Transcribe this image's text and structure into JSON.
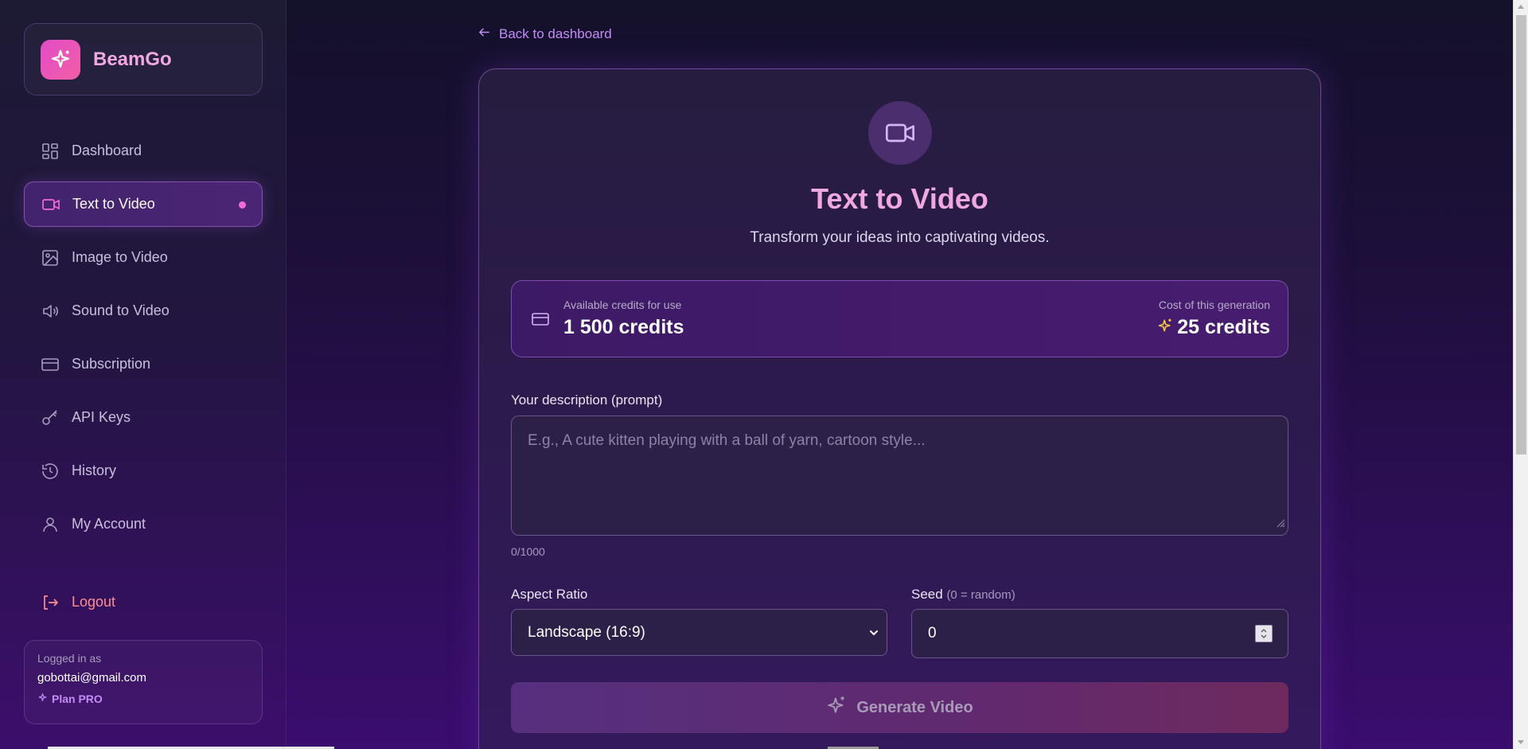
{
  "app": {
    "name": "BeamGo"
  },
  "sidebar": {
    "items": [
      {
        "label": "Dashboard",
        "icon": "dashboard-icon",
        "active": false
      },
      {
        "label": "Text to Video",
        "icon": "video-camera-icon",
        "active": true
      },
      {
        "label": "Image to Video",
        "icon": "image-icon",
        "active": false
      },
      {
        "label": "Sound to Video",
        "icon": "speaker-icon",
        "active": false
      },
      {
        "label": "Subscription",
        "icon": "credit-card-icon",
        "active": false
      },
      {
        "label": "API Keys",
        "icon": "key-icon",
        "active": false
      },
      {
        "label": "History",
        "icon": "history-icon",
        "active": false
      },
      {
        "label": "My Account",
        "icon": "user-icon",
        "active": false
      }
    ],
    "logout_label": "Logout",
    "user": {
      "logged_in_label": "Logged in as",
      "email": "gobottai@gmail.com",
      "plan": "Plan PRO"
    }
  },
  "main": {
    "back_link": "Back to dashboard",
    "title": "Text to Video",
    "subtitle": "Transform your ideas into captivating videos.",
    "credits": {
      "available_label": "Available credits for use",
      "available_value": "1 500 credits",
      "cost_label": "Cost of this generation",
      "cost_value": "25 credits"
    },
    "prompt": {
      "label": "Your description (prompt)",
      "placeholder": "E.g., A cute kitten playing with a ball of yarn, cartoon style...",
      "value": "",
      "char_count": "0/1000"
    },
    "aspect_ratio": {
      "label": "Aspect Ratio",
      "selected": "Landscape (16:9)"
    },
    "seed": {
      "label": "Seed",
      "hint": "(0 = random)",
      "value": "0"
    },
    "generate_label": "Generate Video"
  },
  "colors": {
    "accent_pink": "#f0a8e0",
    "accent_purple": "#c58cf8",
    "logout_red": "#ff8d8d",
    "star_yellow": "#f5c542"
  }
}
